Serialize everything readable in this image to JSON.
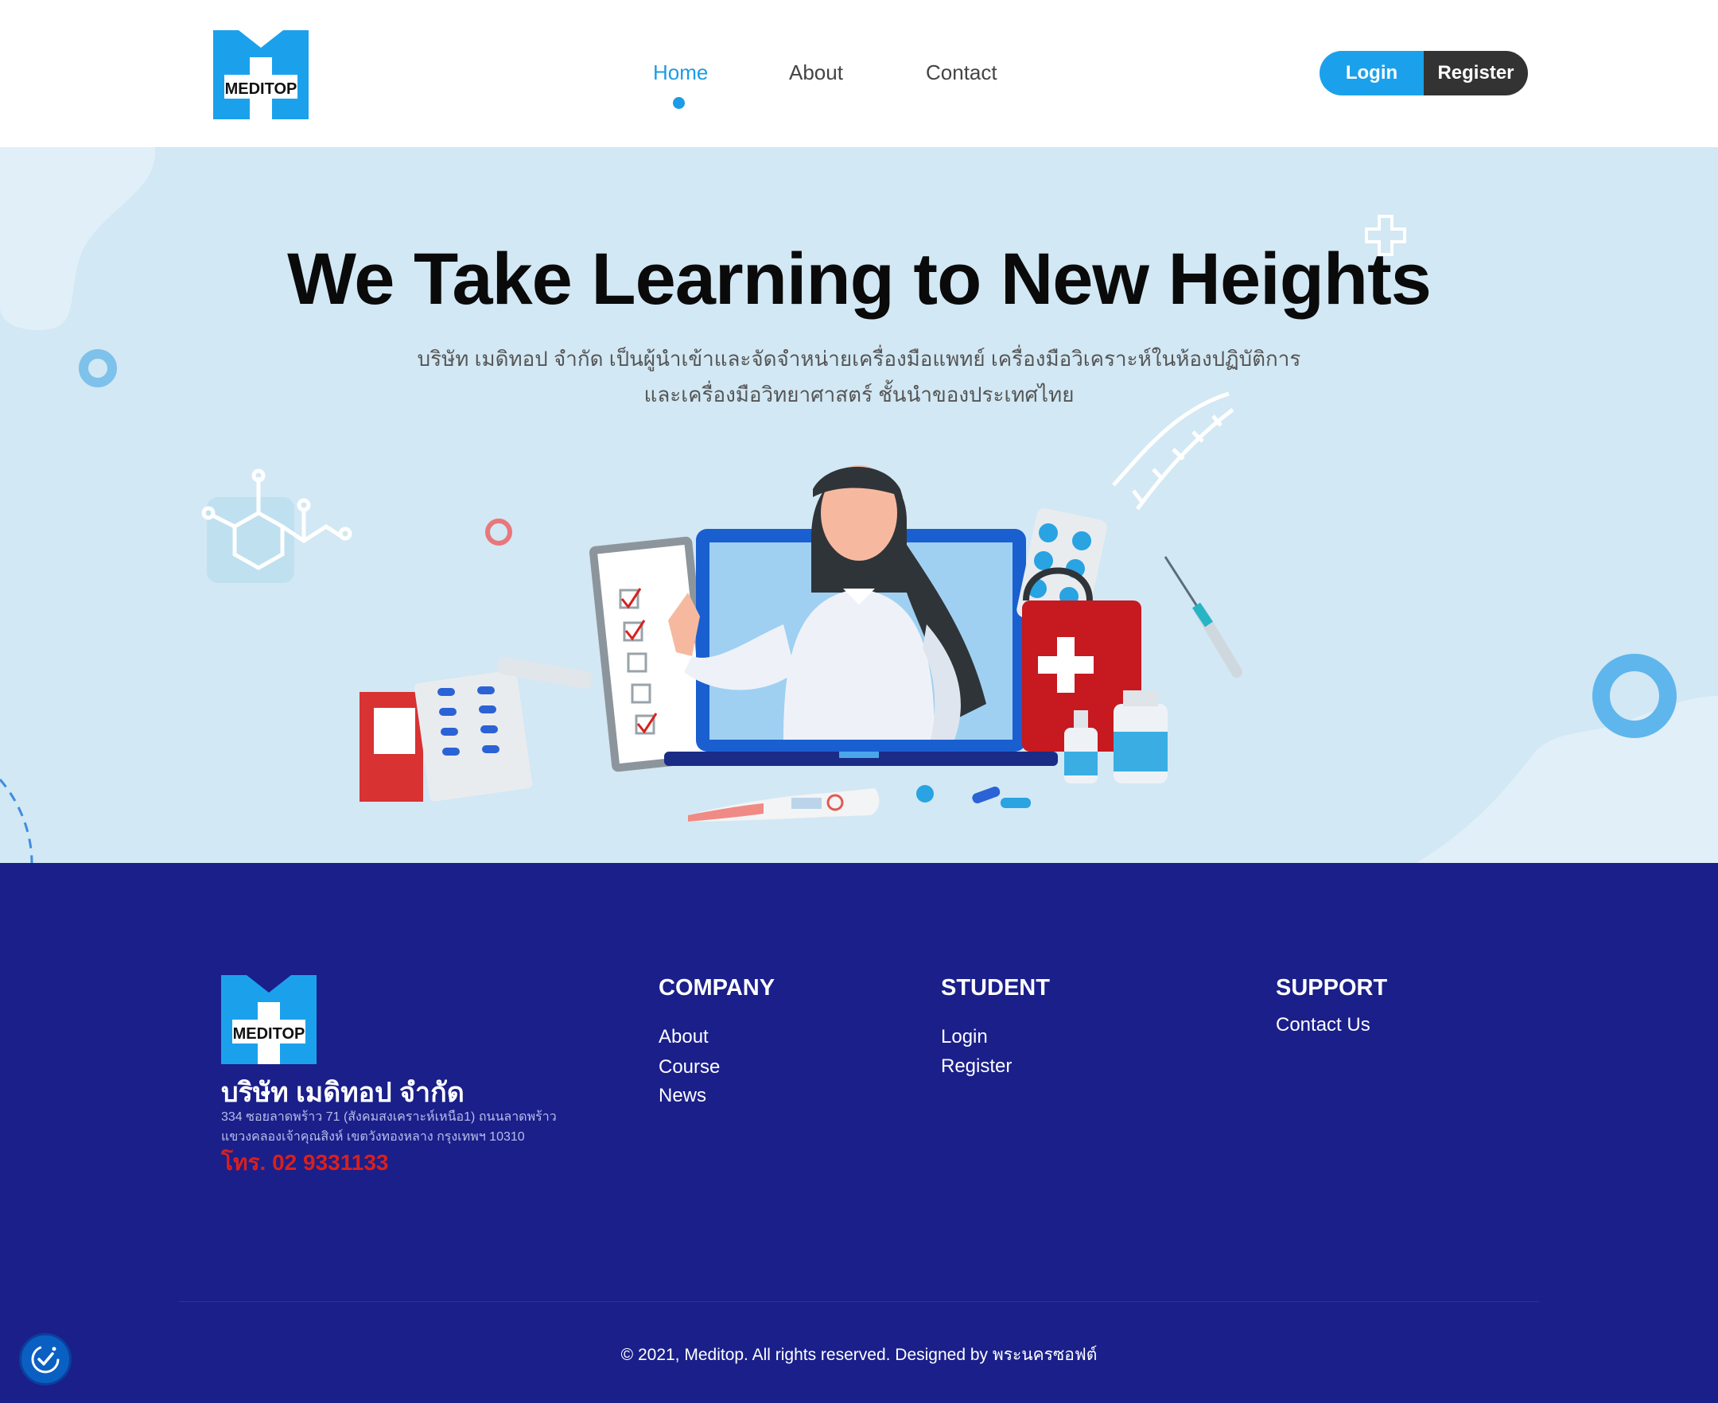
{
  "header": {
    "logo_text": "MEDITOP",
    "nav": [
      {
        "label": "Home",
        "active": true
      },
      {
        "label": "About",
        "active": false
      },
      {
        "label": "Contact",
        "active": false
      }
    ],
    "login_label": "Login",
    "register_label": "Register"
  },
  "hero": {
    "title": "We Take Learning to New Heights",
    "subtitle_line1": "บริษัท เมดิทอป จำกัด เป็นผู้นำเข้าและจัดจำหน่ายเครื่องมือแพทย์ เครื่องมือวิเคราะห์ในห้องปฏิบัติการ",
    "subtitle_line2": "และเครื่องมือวิทยาศาสตร์ ชั้นนำของประเทศไทย"
  },
  "footer": {
    "logo_text": "MEDITOP",
    "company_name": "บริษัท เมดิทอป จำกัด",
    "address_line1": "334 ซอยลาดพร้าว 71 (สังคมสงเคราะห์เหนือ1) ถนนลาดพร้าว",
    "address_line2": "แขวงคลองเจ้าคุณสิงห์ เขตวังทองหลาง กรุงเทพฯ 10310",
    "phone": "โทร. 02 9331133",
    "company": {
      "title": "COMPANY",
      "links": [
        "About",
        "Course",
        "News"
      ]
    },
    "student": {
      "title": "STUDENT",
      "links": [
        "Login",
        "Register"
      ]
    },
    "support": {
      "title": "SUPPORT",
      "links": [
        "Contact Us"
      ]
    },
    "copyright": "© 2021, Meditop. All rights reserved. Designed by พระนครซอฟต์"
  },
  "colors": {
    "primary": "#1ba1ec",
    "dark_button": "#333333",
    "hero_bg": "#d2e8f4",
    "footer_bg": "#1a1f8a",
    "phone_red": "#d8201e"
  }
}
